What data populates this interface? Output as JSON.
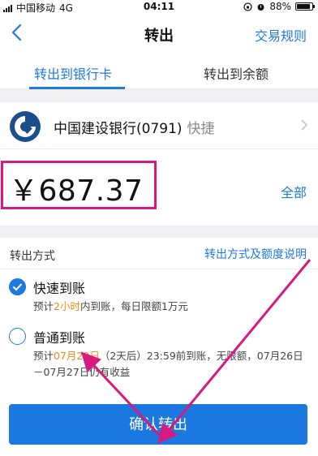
{
  "status_bar": {
    "carrier": "中国移动",
    "network": "4G",
    "time": "04:11",
    "battery": "88%",
    "battery_level": 0.88
  },
  "nav": {
    "title": "转出",
    "rules_link": "交易规则"
  },
  "tabs": [
    {
      "label": "转出到银行卡",
      "active": true
    },
    {
      "label": "转出到余额",
      "active": false
    }
  ],
  "bank": {
    "name": "中国建设银行(0791)",
    "tag": "快捷"
  },
  "amount": {
    "value": "￥687.37",
    "all_link": "全部"
  },
  "method": {
    "header": "转出方式",
    "help_link": "转出方式及额度说明",
    "options": [
      {
        "title": "快速到账",
        "selected": true,
        "desc_pre": "预计",
        "desc_hl": "2小时",
        "desc_post": "内到账，每日限额1万元"
      },
      {
        "title": "普通到账",
        "selected": false,
        "desc_pre": "预计",
        "desc_hl": "07月28日",
        "desc_post": "（2天后）23:59前到账，无限额，07月26日－07月27日仍有收益"
      }
    ]
  },
  "confirm_button": "确认转出",
  "colors": {
    "accent": "#1f7ae0",
    "highlight": "#f08a1c",
    "annotation": "#d61a7f"
  }
}
